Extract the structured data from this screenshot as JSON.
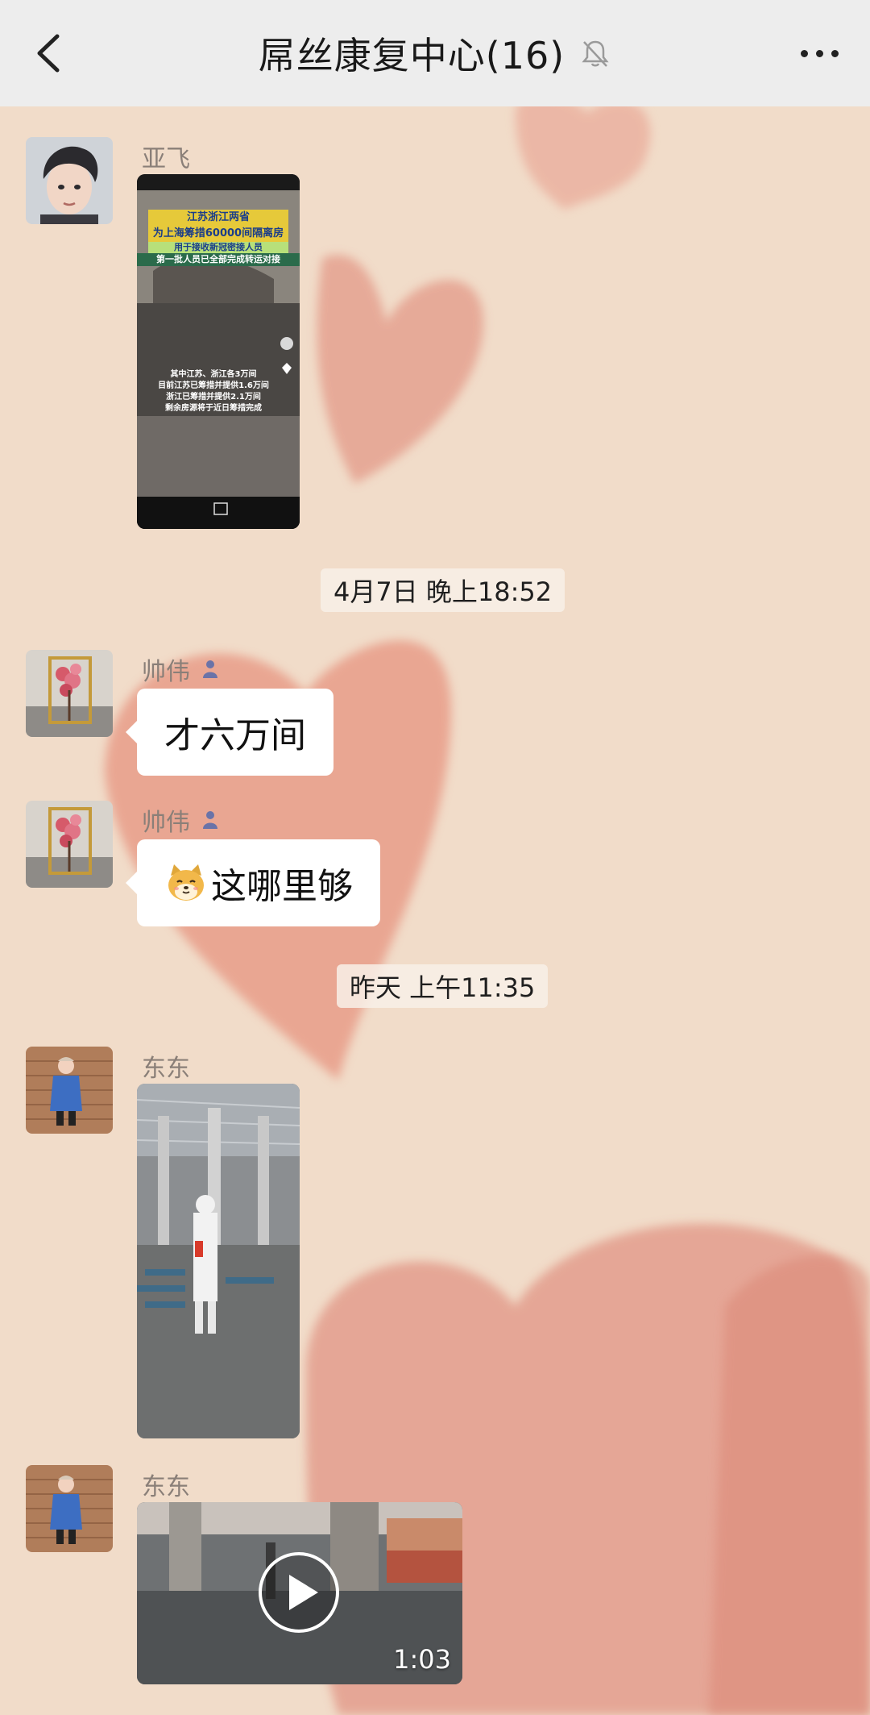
{
  "header": {
    "title": "屌丝康复中心(16)",
    "back_icon": "chevron-left-icon",
    "mute_icon": "bell-off-icon",
    "more_icon": "ellipsis-icon",
    "bg_color": "#ededed"
  },
  "chat_bg_color": "#f1dcc9",
  "messages": [
    {
      "type": "video-thumbnail",
      "sender": "亚飞",
      "thumb_text": {
        "line1": "江苏浙江两省",
        "line2": "为上海筹措60000间隔离房",
        "line3": "用于接收新冠密接人员",
        "line4": "第一批人员已全部完成转运对接",
        "body1": "其中江苏、浙江各3万间",
        "body2": "目前江苏已筹措并提供1.6万间",
        "body3": "浙江已筹措并提供2.1万间",
        "body4": "剩余房源将于近日筹措完成"
      }
    },
    {
      "type": "timestamp",
      "text": "4月7日 晚上18:52"
    },
    {
      "type": "text",
      "sender": "帅伟",
      "admin_icon": "person-badge-icon",
      "text": "才六万间"
    },
    {
      "type": "text",
      "sender": "帅伟",
      "admin_icon": "person-badge-icon",
      "emoji": "shiba-dog-emoji",
      "text": "这哪里够"
    },
    {
      "type": "timestamp",
      "text": "昨天 上午11:35"
    },
    {
      "type": "image",
      "sender": "东东"
    },
    {
      "type": "video",
      "sender": "东东",
      "duration": "1:03"
    }
  ]
}
